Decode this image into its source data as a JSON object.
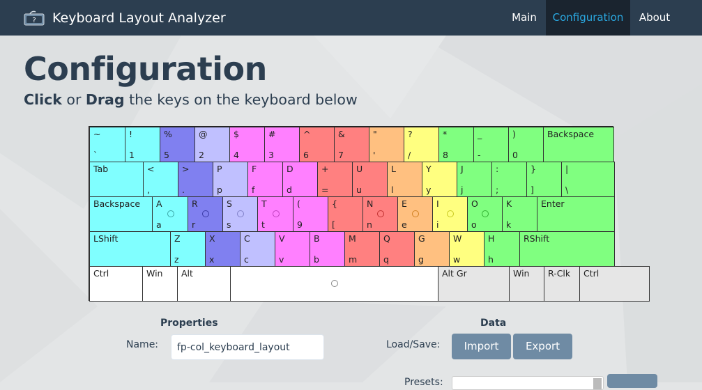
{
  "navbar": {
    "brand": "Keyboard Layout Analyzer",
    "items": [
      {
        "label": "Main"
      },
      {
        "label": "Configuration"
      },
      {
        "label": "About"
      }
    ]
  },
  "header": {
    "title": "Configuration",
    "subtitle_click": "Click",
    "subtitle_or": " or ",
    "subtitle_drag": "Drag",
    "subtitle_rest": " the keys on the keyboard below"
  },
  "colors": {
    "cyan": "#80ffff",
    "blue": "#8080f0",
    "lavender": "#c0c0ff",
    "magenta": "#ff80ff",
    "red": "#ff8080",
    "orange": "#ffc080",
    "yellow": "#ffff80",
    "green": "#80ff80",
    "white": "#ffffff",
    "gray": "#e6e6e6"
  },
  "keyboard": {
    "rows": [
      [
        {
          "top": "~",
          "bot": "`",
          "color": "cyan"
        },
        {
          "top": "!",
          "bot": "1",
          "color": "cyan"
        },
        {
          "top": "%",
          "bot": "5",
          "color": "blue"
        },
        {
          "top": "@",
          "bot": "2",
          "color": "lavender"
        },
        {
          "top": "$",
          "bot": "4",
          "color": "magenta"
        },
        {
          "top": "#",
          "bot": "3",
          "color": "magenta"
        },
        {
          "top": "^",
          "bot": "6",
          "color": "red"
        },
        {
          "top": "&",
          "bot": "7",
          "color": "red"
        },
        {
          "top": "\"",
          "bot": "'",
          "color": "orange"
        },
        {
          "top": "?",
          "bot": "/",
          "color": "yellow"
        },
        {
          "top": "*",
          "bot": "8",
          "color": "green"
        },
        {
          "top": "_",
          "bot": "-",
          "color": "green"
        },
        {
          "top": ")",
          "bot": "0",
          "color": "green"
        },
        {
          "top": "Backspace",
          "bot": "",
          "color": "green"
        }
      ],
      [
        {
          "top": "Tab",
          "bot": "",
          "color": "cyan"
        },
        {
          "top": "<",
          "bot": ",",
          "color": "cyan"
        },
        {
          "top": ">",
          "bot": ".",
          "color": "blue"
        },
        {
          "top": "P",
          "bot": "p",
          "color": "lavender"
        },
        {
          "top": "F",
          "bot": "f",
          "color": "magenta"
        },
        {
          "top": "D",
          "bot": "d",
          "color": "magenta"
        },
        {
          "top": "+",
          "bot": "=",
          "color": "red"
        },
        {
          "top": "U",
          "bot": "u",
          "color": "red"
        },
        {
          "top": "L",
          "bot": "l",
          "color": "orange"
        },
        {
          "top": "Y",
          "bot": "y",
          "color": "yellow"
        },
        {
          "top": "J",
          "bot": "j",
          "color": "green"
        },
        {
          "top": ":",
          "bot": ";",
          "color": "green"
        },
        {
          "top": "}",
          "bot": "]",
          "color": "green"
        },
        {
          "top": "|",
          "bot": "\\",
          "color": "green"
        }
      ],
      [
        {
          "top": "Backspace",
          "bot": "",
          "color": "cyan"
        },
        {
          "top": "A",
          "bot": "a",
          "color": "cyan",
          "dot": "#3aa6a6"
        },
        {
          "top": "R",
          "bot": "r",
          "color": "blue",
          "dot": "#3a3aa6"
        },
        {
          "top": "S",
          "bot": "s",
          "color": "lavender",
          "dot": "#8080c8"
        },
        {
          "top": "T",
          "bot": "t",
          "color": "magenta",
          "dot": "#c040c0"
        },
        {
          "top": "(",
          "bot": "9",
          "color": "magenta"
        },
        {
          "top": "{",
          "bot": "[",
          "color": "red"
        },
        {
          "top": "N",
          "bot": "n",
          "color": "red",
          "dot": "#c03030"
        },
        {
          "top": "E",
          "bot": "e",
          "color": "orange",
          "dot": "#d08020"
        },
        {
          "top": "I",
          "bot": "i",
          "color": "yellow",
          "dot": "#c8c820"
        },
        {
          "top": "O",
          "bot": "o",
          "color": "green",
          "dot": "#30b030"
        },
        {
          "top": "K",
          "bot": "k",
          "color": "green"
        },
        {
          "top": "Enter",
          "bot": "",
          "color": "green"
        }
      ],
      [
        {
          "top": "LShift",
          "bot": "",
          "color": "cyan"
        },
        {
          "top": "Z",
          "bot": "z",
          "color": "cyan"
        },
        {
          "top": "X",
          "bot": "x",
          "color": "blue"
        },
        {
          "top": "C",
          "bot": "c",
          "color": "lavender"
        },
        {
          "top": "V",
          "bot": "v",
          "color": "magenta"
        },
        {
          "top": "B",
          "bot": "b",
          "color": "magenta"
        },
        {
          "top": "M",
          "bot": "m",
          "color": "red"
        },
        {
          "top": "Q",
          "bot": "q",
          "color": "red"
        },
        {
          "top": "G",
          "bot": "g",
          "color": "orange"
        },
        {
          "top": "W",
          "bot": "w",
          "color": "yellow"
        },
        {
          "top": "H",
          "bot": "h",
          "color": "green"
        },
        {
          "top": "RShift",
          "bot": "",
          "color": "green"
        }
      ],
      [
        {
          "top": "Ctrl",
          "bot": "",
          "color": "white"
        },
        {
          "top": "Win",
          "bot": "",
          "color": "white"
        },
        {
          "top": "Alt",
          "bot": "",
          "color": "white"
        },
        {
          "top": "",
          "bot": "",
          "color": "white",
          "dot": "#888888"
        },
        {
          "top": "Alt Gr",
          "bot": "",
          "color": "gray"
        },
        {
          "top": "Win",
          "bot": "",
          "color": "gray"
        },
        {
          "top": "R-Clk",
          "bot": "",
          "color": "gray"
        },
        {
          "top": "Ctrl",
          "bot": "",
          "color": "gray"
        }
      ]
    ]
  },
  "properties": {
    "title": "Properties",
    "name_label": "Name:",
    "name_value": "fp-col_keyboard_layout"
  },
  "data_section": {
    "title": "Data",
    "loadsave_label": "Load/Save:",
    "import_label": "Import",
    "export_label": "Export",
    "presets_label": "Presets:"
  }
}
